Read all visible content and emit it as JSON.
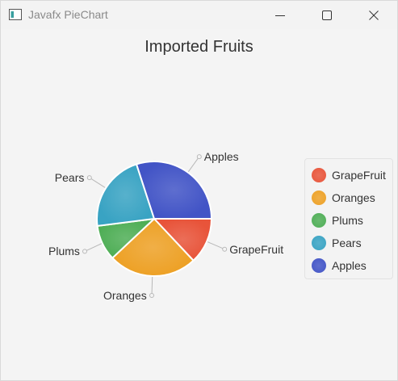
{
  "window": {
    "title": "Javafx PieChart",
    "icon": "app-window-icon",
    "controls": [
      "minimize-icon",
      "maximize-icon",
      "close-icon"
    ]
  },
  "chart_data": {
    "type": "pie",
    "title": "Imported Fruits",
    "slices": [
      {
        "name": "GrapeFruit",
        "value": 13,
        "color": "#e8543a"
      },
      {
        "name": "Oranges",
        "value": 25,
        "color": "#eda126"
      },
      {
        "name": "Plums",
        "value": 10,
        "color": "#4fae56"
      },
      {
        "name": "Pears",
        "value": 22,
        "color": "#39a3c3"
      },
      {
        "name": "Apples",
        "value": 30,
        "color": "#4254c6"
      }
    ],
    "start_angle_deg": 0,
    "direction": "clockwise-from-3-oclock",
    "legend_position": "right"
  },
  "legend": {
    "items": [
      "GrapeFruit",
      "Oranges",
      "Plums",
      "Pears",
      "Apples"
    ]
  }
}
